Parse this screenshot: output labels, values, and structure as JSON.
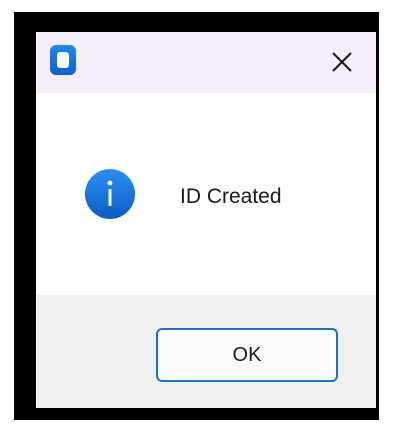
{
  "dialog": {
    "message": "ID Created",
    "ok_label": "OK",
    "colors": {
      "titlebar": "#f5eef9",
      "footer": "#f0f0f0",
      "accent": "#1a73c9",
      "info_icon": "#1976d2"
    },
    "icons": [
      "app-icon",
      "close-icon",
      "info-icon"
    ]
  }
}
